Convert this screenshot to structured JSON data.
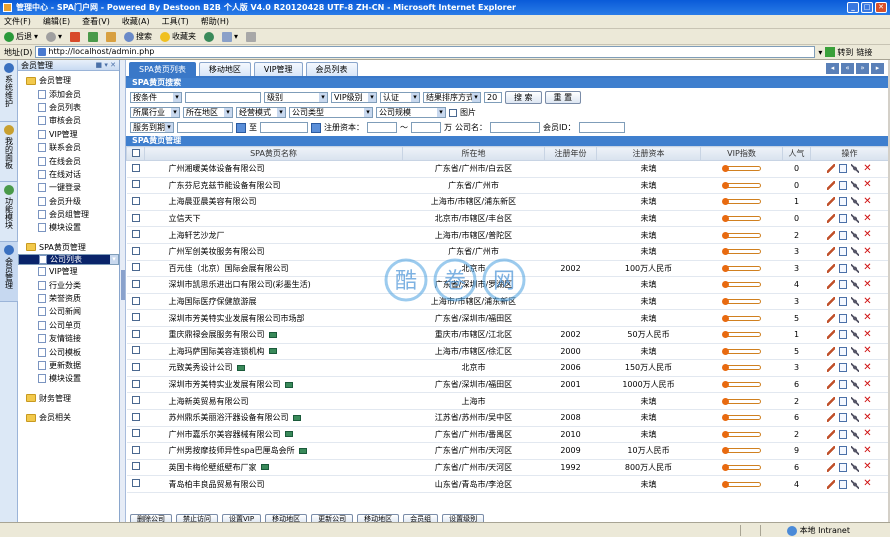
{
  "window": {
    "title": "管理中心 - SPA门户网 - Powered By Destoon B2B 个人版 V4.0 R20120428 UTF-8 ZH-CN - Microsoft Internet Explorer"
  },
  "menu": [
    "文件(F)",
    "编辑(E)",
    "查看(V)",
    "收藏(A)",
    "工具(T)",
    "帮助(H)"
  ],
  "toolbar": {
    "back": "后退",
    "search": "搜索",
    "favorites": "收藏夹"
  },
  "address": {
    "label": "地址(D)",
    "url": "http://localhost/admin.php",
    "go": "转到",
    "links": "链接"
  },
  "vtabs": [
    "系统维护",
    "我的面板",
    "功能模块",
    "会员管理"
  ],
  "sidebar": {
    "header": "会员管理",
    "pins": "■ ▾ ✕",
    "tree": [
      {
        "label": "会员管理",
        "level": 0,
        "type": "folder"
      },
      {
        "label": "添加会员",
        "level": 1,
        "type": "leaf"
      },
      {
        "label": "会员列表",
        "level": 1,
        "type": "leaf"
      },
      {
        "label": "审核会员",
        "level": 1,
        "type": "leaf"
      },
      {
        "label": "VIP管理",
        "level": 1,
        "type": "leaf"
      },
      {
        "label": "联系会员",
        "level": 1,
        "type": "leaf"
      },
      {
        "label": "在线会员",
        "level": 1,
        "type": "leaf"
      },
      {
        "label": "在线对话",
        "level": 1,
        "type": "leaf"
      },
      {
        "label": "一键登录",
        "level": 1,
        "type": "leaf"
      },
      {
        "label": "会员升级",
        "level": 1,
        "type": "leaf"
      },
      {
        "label": "会员组管理",
        "level": 1,
        "type": "leaf"
      },
      {
        "label": "模块设置",
        "level": 1,
        "type": "leaf"
      },
      {
        "label": "SPA黄页管理",
        "level": 0,
        "type": "folder"
      },
      {
        "label": "公司列表",
        "level": 1,
        "type": "leaf",
        "selected": true
      },
      {
        "label": "VIP管理",
        "level": 1,
        "type": "leaf"
      },
      {
        "label": "行业分类",
        "level": 1,
        "type": "leaf"
      },
      {
        "label": "荣誉资质",
        "level": 1,
        "type": "leaf"
      },
      {
        "label": "公司新闻",
        "level": 1,
        "type": "leaf"
      },
      {
        "label": "公司单页",
        "level": 1,
        "type": "leaf"
      },
      {
        "label": "友情链接",
        "level": 1,
        "type": "leaf"
      },
      {
        "label": "公司模板",
        "level": 1,
        "type": "leaf"
      },
      {
        "label": "更新数据",
        "level": 1,
        "type": "leaf"
      },
      {
        "label": "模块设置",
        "level": 1,
        "type": "leaf"
      },
      {
        "label": "财务管理",
        "level": 0,
        "type": "folder"
      },
      {
        "label": "会员相关",
        "level": 0,
        "type": "folder"
      }
    ]
  },
  "tabs": [
    {
      "label": "SPA黄页列表",
      "active": true
    },
    {
      "label": "移动地区",
      "active": false
    },
    {
      "label": "VIP管理",
      "active": false
    },
    {
      "label": "会员列表",
      "active": false
    }
  ],
  "tab_controls": [
    "◂",
    "«",
    "»",
    "▸"
  ],
  "search": {
    "section_title": "SPA黄页搜索",
    "row1": {
      "condition": "按条件",
      "level": "级别",
      "vip_level": "VIP级别",
      "auth": "认证",
      "sort": "结果排序方式",
      "page_size": "20",
      "search_btn": "搜 索",
      "reset_btn": "重 置"
    },
    "row2": {
      "industry": "所属行业",
      "region": "所在地区",
      "mode": "经营模式",
      "company_type": "公司类型",
      "company_scale": "公司规模",
      "picture": "图片"
    },
    "row3": {
      "service_expire": "服务到期",
      "to": "至",
      "capital": "注册资本：",
      "tilde": "～",
      "wan": "万",
      "company_name": "公司名：",
      "member_id": "会员ID："
    }
  },
  "list": {
    "section_title": "SPA黄页管理",
    "columns": [
      "",
      "SPA黄页名称",
      "所在地",
      "注册年份",
      "注册资本",
      "VIP指数",
      "人气",
      "操作"
    ],
    "rows": [
      {
        "name": "广州湘暖美体设备有限公司",
        "loc": "广东省/广州市/白云区",
        "year": "",
        "capital": "未填",
        "pop": "0",
        "badge": false
      },
      {
        "name": "广东芬尼克兹节能设备有限公司",
        "loc": "广东省/广州市",
        "year": "",
        "capital": "未填",
        "pop": "0",
        "badge": false
      },
      {
        "name": "上海晨亚晨美容有限公司",
        "loc": "上海市/市辖区/浦东新区",
        "year": "",
        "capital": "未填",
        "pop": "1",
        "badge": false
      },
      {
        "name": "立信天下",
        "loc": "北京市/市辖区/丰台区",
        "year": "",
        "capital": "未填",
        "pop": "0",
        "badge": false
      },
      {
        "name": "上海轩艺沙龙厂",
        "loc": "上海市/市辖区/普陀区",
        "year": "",
        "capital": "未填",
        "pop": "2",
        "badge": false
      },
      {
        "name": "广州军创美妆服务有限公司",
        "loc": "广东省/广州市",
        "year": "",
        "capital": "未填",
        "pop": "3",
        "badge": false
      },
      {
        "name": "百元佳（北京）国际会展有限公司",
        "loc": "北京市",
        "year": "2002",
        "capital": "100万人民币",
        "pop": "3",
        "badge": false
      },
      {
        "name": "深圳市凯思乐进出口有限公司(彩墨生活)",
        "loc": "广东省/深圳市/罗湖区",
        "year": "",
        "capital": "未填",
        "pop": "4",
        "badge": false
      },
      {
        "name": "上海国际医疗保健旅游展",
        "loc": "上海市/市辖区/浦东新区",
        "year": "",
        "capital": "未填",
        "pop": "3",
        "badge": false
      },
      {
        "name": "深圳市芳美特实业发展有限公司市场部",
        "loc": "广东省/深圳市/福田区",
        "year": "",
        "capital": "未填",
        "pop": "5",
        "badge": false
      },
      {
        "name": "重庆鼎禄会展服务有限公司",
        "loc": "重庆市/市辖区/江北区",
        "year": "2002",
        "capital": "50万人民币",
        "pop": "1",
        "badge": true
      },
      {
        "name": "上海玛萨国际美容连锁机构",
        "loc": "上海市/市辖区/徐汇区",
        "year": "2000",
        "capital": "未填",
        "pop": "5",
        "badge": true
      },
      {
        "name": "元致美秀设计公司",
        "loc": "北京市",
        "year": "2006",
        "capital": "150万人民币",
        "pop": "3",
        "badge": true
      },
      {
        "name": "深圳市芳美特实业发展有限公司",
        "loc": "广东省/深圳市/福田区",
        "year": "2001",
        "capital": "1000万人民币",
        "pop": "6",
        "badge": true
      },
      {
        "name": "上海新英贸易有限公司",
        "loc": "上海市",
        "year": "",
        "capital": "未填",
        "pop": "2",
        "badge": false
      },
      {
        "name": "苏州鼎乐美丽浴汗器设备有限公司",
        "loc": "江苏省/苏州市/吴中区",
        "year": "2008",
        "capital": "未填",
        "pop": "6",
        "badge": true
      },
      {
        "name": "广州市嘉乐尔美容器械有限公司",
        "loc": "广东省/广州市/番禺区",
        "year": "2010",
        "capital": "未填",
        "pop": "2",
        "badge": true
      },
      {
        "name": "广州男按摩技师异性spa巴厘岛会所",
        "loc": "广东省/广州市/天河区",
        "year": "2009",
        "capital": "10万人民币",
        "pop": "9",
        "badge": true
      },
      {
        "name": "英国卡梅伦壁纸壁布厂家",
        "loc": "广东省/广州市/天河区",
        "year": "1992",
        "capital": "800万人民币",
        "pop": "6",
        "badge": true
      },
      {
        "name": "青岛柏丰良品贸易有限公司",
        "loc": "山东省/青岛市/李沧区",
        "year": "",
        "capital": "未填",
        "pop": "4",
        "badge": false
      }
    ]
  },
  "bottom_buttons": [
    "删除公司",
    "禁止访问",
    "设置VIP",
    "移动地区",
    "更新公司",
    "移动地区",
    "会员组",
    "设置级别"
  ],
  "status": {
    "text": "",
    "zone": "本地 Intranet"
  },
  "watermark": "酷卷网"
}
